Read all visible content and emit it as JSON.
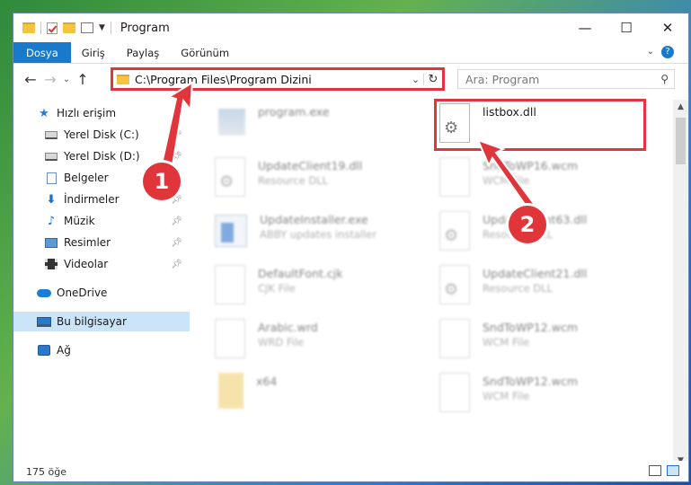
{
  "window": {
    "title": "Program",
    "controls": {
      "minimize": "—",
      "maximize": "☐",
      "close": "✕"
    }
  },
  "ribbon": {
    "tabs": [
      "Dosya",
      "Giriş",
      "Paylaş",
      "Görünüm"
    ],
    "active_tab": "Dosya",
    "help": "?"
  },
  "navigation": {
    "address": "C:\\Program Files\\Program Dizini",
    "search_placeholder": "Ara: Program"
  },
  "sidebar": {
    "items": [
      {
        "label": "Hızlı erişim",
        "icon": "star-icon",
        "pinned": false
      },
      {
        "label": "Yerel Disk (C:)",
        "icon": "drive-icon",
        "pinned": true
      },
      {
        "label": "Yerel Disk (D:)",
        "icon": "drive-icon",
        "pinned": true
      },
      {
        "label": "Belgeler",
        "icon": "document-icon",
        "pinned": true
      },
      {
        "label": "İndirmeler",
        "icon": "download-icon",
        "pinned": true
      },
      {
        "label": "Müzik",
        "icon": "music-icon",
        "pinned": true
      },
      {
        "label": "Resimler",
        "icon": "pictures-icon",
        "pinned": true
      },
      {
        "label": "Videolar",
        "icon": "video-icon",
        "pinned": true
      },
      {
        "label": "OneDrive",
        "icon": "cloud-icon",
        "pinned": false
      },
      {
        "label": "Bu bilgisayar",
        "icon": "computer-icon",
        "pinned": false,
        "selected": true
      },
      {
        "label": "Ağ",
        "icon": "network-icon",
        "pinned": false
      }
    ]
  },
  "files": [
    {
      "name": "program.exe",
      "type": "",
      "icon": "exe-icon",
      "blurred": true
    },
    {
      "name": "listbox.dll",
      "type": "",
      "icon": "dll-icon",
      "blurred": false,
      "highlighted": true
    },
    {
      "name": "UpdateClient19.dll",
      "type": "Resource DLL",
      "icon": "dll-icon",
      "blurred": true
    },
    {
      "name": "SndToWP16.wcm",
      "type": "WCM File",
      "icon": "file-icon",
      "blurred": true
    },
    {
      "name": "UpdateInstaller.exe",
      "type": "ABBY updates installer",
      "icon": "app-icon",
      "blurred": true
    },
    {
      "name": "UpdateClient63.dll",
      "type": "Resource DLL",
      "icon": "dll-icon",
      "blurred": true
    },
    {
      "name": "DefaultFont.cjk",
      "type": "CJK File",
      "icon": "file-icon",
      "blurred": true
    },
    {
      "name": "UpdateClient21.dll",
      "type": "Resource DLL",
      "icon": "dll-icon",
      "blurred": true
    },
    {
      "name": "Arabic.wrd",
      "type": "WRD File",
      "icon": "file-icon",
      "blurred": true
    },
    {
      "name": "SndToWP12.wcm",
      "type": "WCM File",
      "icon": "file-icon",
      "blurred": true
    },
    {
      "name": "x64",
      "type": "",
      "icon": "folder-icon",
      "blurred": true
    },
    {
      "name": "SndToWP12.wcm",
      "type": "WCM File",
      "icon": "file-icon",
      "blurred": true
    }
  ],
  "status": {
    "item_count": "175 öğe"
  },
  "annotations": {
    "step1": "1",
    "step2": "2",
    "color": "#e0353b"
  }
}
